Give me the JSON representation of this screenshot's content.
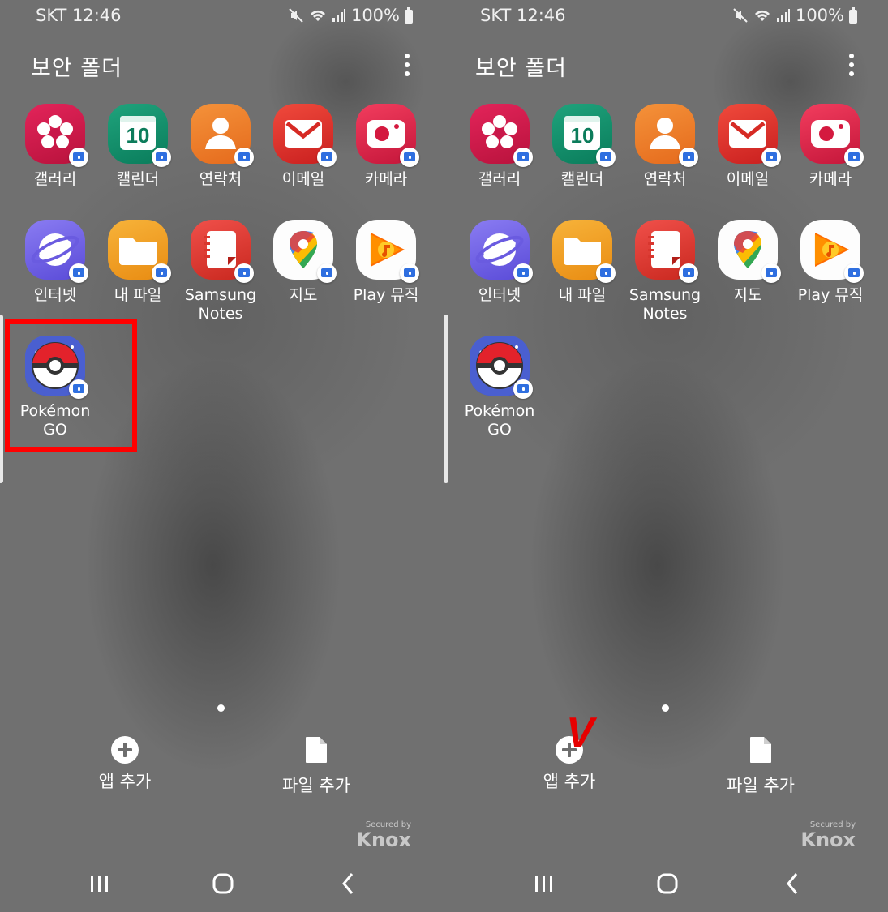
{
  "screens": [
    {
      "status": {
        "carrier_time": "SKT 12:46",
        "battery": "100%"
      },
      "folder_title": "보안 폴더",
      "apps": [
        {
          "label": "갤러리",
          "icon": "gallery-icon"
        },
        {
          "label": "캘린더",
          "icon": "calendar-icon",
          "day": "10"
        },
        {
          "label": "연락처",
          "icon": "contacts-icon"
        },
        {
          "label": "이메일",
          "icon": "email-icon"
        },
        {
          "label": "카메라",
          "icon": "camera-icon"
        },
        {
          "label": "인터넷",
          "icon": "internet-icon"
        },
        {
          "label": "내 파일",
          "icon": "my-files-icon"
        },
        {
          "label": "Samsung Notes",
          "icon": "samsung-notes-icon"
        },
        {
          "label": "지도",
          "icon": "maps-icon"
        },
        {
          "label": "Play 뮤직",
          "icon": "play-music-icon"
        },
        {
          "label": "Pokémon GO",
          "icon": "pokemon-go-icon"
        }
      ],
      "actions": {
        "add_app": "앱 추가",
        "add_file": "파일 추가"
      },
      "knox": {
        "secured_by": "Secured by",
        "brand": "Knox"
      },
      "highlight": "Pokémon GO"
    },
    {
      "status": {
        "carrier_time": "SKT 12:46",
        "battery": "100%"
      },
      "folder_title": "보안 폴더",
      "apps": [
        {
          "label": "갤러리",
          "icon": "gallery-icon"
        },
        {
          "label": "캘린더",
          "icon": "calendar-icon",
          "day": "10"
        },
        {
          "label": "연락처",
          "icon": "contacts-icon"
        },
        {
          "label": "이메일",
          "icon": "email-icon"
        },
        {
          "label": "카메라",
          "icon": "camera-icon"
        },
        {
          "label": "인터넷",
          "icon": "internet-icon"
        },
        {
          "label": "내 파일",
          "icon": "my-files-icon"
        },
        {
          "label": "Samsung Notes",
          "icon": "samsung-notes-icon"
        },
        {
          "label": "지도",
          "icon": "maps-icon"
        },
        {
          "label": "Play 뮤직",
          "icon": "play-music-icon"
        },
        {
          "label": "Pokémon GO",
          "icon": "pokemon-go-icon"
        }
      ],
      "actions": {
        "add_app": "앱 추가",
        "add_file": "파일 추가"
      },
      "knox": {
        "secured_by": "Secured by",
        "brand": "Knox"
      },
      "annotation_mark": "V"
    }
  ],
  "colors": {
    "highlight": "#ff0000",
    "annotation": "#e60000",
    "wallpaper": "#707070"
  }
}
